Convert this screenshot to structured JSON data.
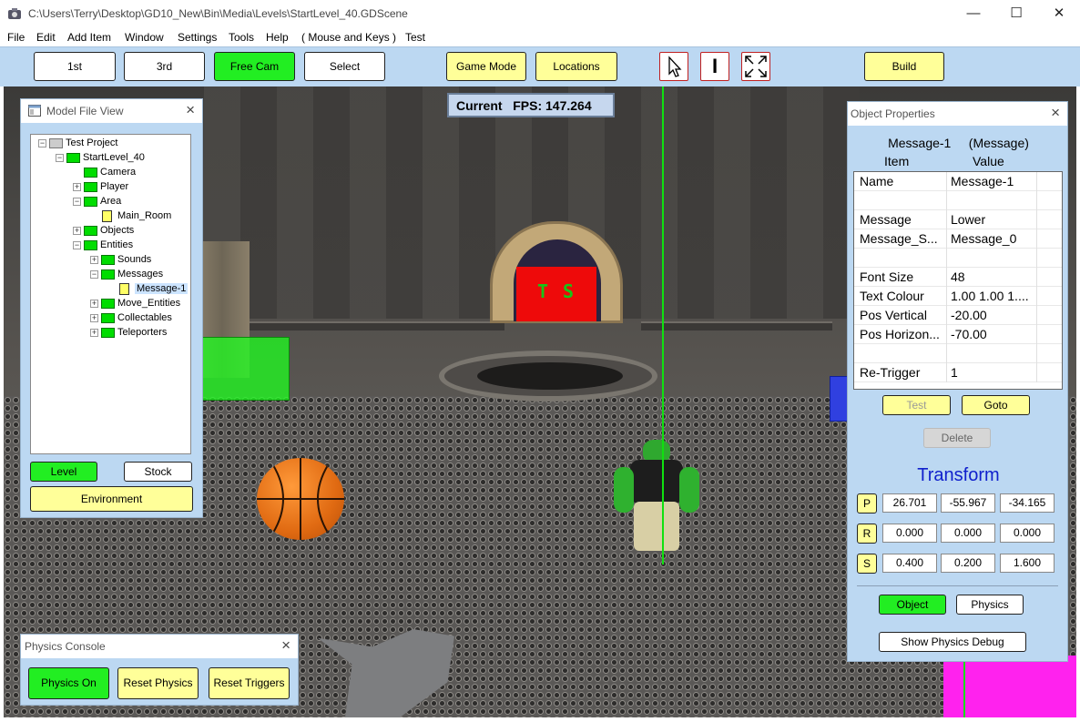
{
  "window": {
    "title": "C:\\Users\\Terry\\Desktop\\GD10_New\\Bin\\Media\\Levels\\StartLevel_40.GDScene",
    "minimize": "—",
    "maximize": "☐",
    "close": "✕"
  },
  "menu": [
    "File",
    "Edit",
    "Add Item",
    "Window",
    "Settings",
    "Tools",
    "Help",
    "( Mouse and Keys )",
    "Test"
  ],
  "toolbar": {
    "first": "1st",
    "third": "3rd",
    "free_cam": "Free Cam",
    "select": "Select",
    "game_mode": "Game Mode",
    "locations": "Locations",
    "build": "Build",
    "text_tool": "I"
  },
  "fps": {
    "label": "Current   FPS:",
    "value": "147.264"
  },
  "scene": {
    "sign_text": "T S"
  },
  "model_file_view": {
    "title": "Model File View",
    "tree": [
      {
        "label": "Test Project",
        "depth": 0,
        "icon": "folder-gray",
        "exp": "−"
      },
      {
        "label": "StartLevel_40",
        "depth": 1,
        "icon": "folder",
        "exp": "−"
      },
      {
        "label": "Camera",
        "depth": 2,
        "icon": "folder",
        "exp": ""
      },
      {
        "label": "Player",
        "depth": 2,
        "icon": "folder",
        "exp": "+"
      },
      {
        "label": "Area",
        "depth": 2,
        "icon": "folder",
        "exp": "−"
      },
      {
        "label": "Main_Room",
        "depth": 3,
        "icon": "doc",
        "exp": ""
      },
      {
        "label": "Objects",
        "depth": 2,
        "icon": "folder",
        "exp": "+"
      },
      {
        "label": "Entities",
        "depth": 2,
        "icon": "folder",
        "exp": "−"
      },
      {
        "label": "Sounds",
        "depth": 3,
        "icon": "folder",
        "exp": "+"
      },
      {
        "label": "Messages",
        "depth": 3,
        "icon": "folder",
        "exp": "−"
      },
      {
        "label": "Message-1",
        "depth": 4,
        "icon": "doc",
        "exp": "",
        "selected": true
      },
      {
        "label": "Move_Entities",
        "depth": 3,
        "icon": "folder",
        "exp": "+"
      },
      {
        "label": "Collectables",
        "depth": 3,
        "icon": "folder",
        "exp": "+"
      },
      {
        "label": "Teleporters",
        "depth": 3,
        "icon": "folder",
        "exp": "+"
      }
    ],
    "level_btn": "Level",
    "stock_btn": "Stock",
    "environment_btn": "Environment"
  },
  "physics_console": {
    "title": "Physics Console",
    "physics_on": "Physics On",
    "reset_physics": "Reset Physics",
    "reset_triggers": "Reset Triggers"
  },
  "object_properties": {
    "title": "Object Properties",
    "heading": "Message-1     (Message)",
    "col_item": "Item",
    "col_value": "Value",
    "rows": [
      {
        "k": "Name",
        "v": "Message-1"
      },
      {
        "k": "",
        "v": ""
      },
      {
        "k": "Message",
        "v": "Lower"
      },
      {
        "k": "Message_S...",
        "v": "Message_0"
      },
      {
        "k": "",
        "v": ""
      },
      {
        "k": "Font Size",
        "v": "48"
      },
      {
        "k": "Text Colour",
        "v": "1.00 1.00 1...."
      },
      {
        "k": "Pos Vertical",
        "v": "-20.00"
      },
      {
        "k": "Pos Horizon...",
        "v": "-70.00"
      },
      {
        "k": "",
        "v": ""
      },
      {
        "k": "Re-Trigger",
        "v": "1"
      }
    ],
    "test_btn": "Test",
    "goto_btn": "Goto",
    "delete_btn": "Delete",
    "transform_title": "Transform",
    "p_label": "P",
    "r_label": "R",
    "s_label": "S",
    "p": [
      "26.701",
      "-55.967",
      "-34.165"
    ],
    "r": [
      "0.000",
      "0.000",
      "0.000"
    ],
    "s": [
      "0.400",
      "0.200",
      "1.600"
    ],
    "object_btn": "Object",
    "physics_btn": "Physics",
    "show_debug_btn": "Show Physics Debug"
  },
  "colors": {
    "panel_bg": "#bcd8f2",
    "button_yellow": "#ffff99",
    "button_green": "#22ee22",
    "transform_blue": "#1020cc"
  }
}
